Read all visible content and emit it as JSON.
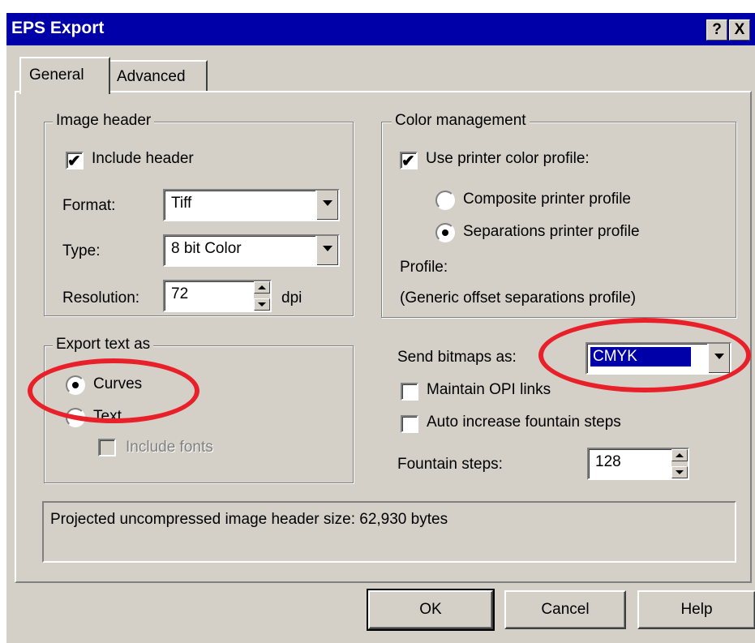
{
  "window": {
    "title": "EPS Export",
    "help_label": "?",
    "close_label": "X"
  },
  "tabs": [
    {
      "label": "General"
    },
    {
      "label": "Advanced"
    }
  ],
  "image_header": {
    "legend": "Image header",
    "include_header": {
      "label": "Include header",
      "checked": true
    },
    "format": {
      "label": "Format:",
      "value": "Tiff"
    },
    "type": {
      "label": "Type:",
      "value": "8 bit Color"
    },
    "resolution": {
      "label": "Resolution:",
      "value": "72",
      "unit": "dpi"
    }
  },
  "color_management": {
    "legend": "Color management",
    "use_printer_profile": {
      "label": "Use printer color profile:",
      "checked": true
    },
    "composite": {
      "label": "Composite printer profile",
      "selected": false
    },
    "separations": {
      "label": "Separations printer profile",
      "selected": true
    },
    "profile_label": "Profile:",
    "profile_value": "(Generic offset separations profile)"
  },
  "export_text": {
    "legend": "Export text as",
    "curves": {
      "label": "Curves",
      "selected": true
    },
    "text": {
      "label": "Text",
      "selected": false
    },
    "include_fonts": {
      "label": "Include fonts",
      "enabled": false
    }
  },
  "bitmaps": {
    "label": "Send bitmaps as:",
    "value": "CMYK",
    "maintain_opi": {
      "label": "Maintain OPI links",
      "checked": false
    },
    "auto_increase": {
      "label": "Auto increase fountain steps",
      "checked": false
    },
    "fountain_label": "Fountain steps:",
    "fountain_value": "128"
  },
  "status": {
    "text": "Projected uncompressed image header size: 62,930 bytes"
  },
  "buttons": {
    "ok": "OK",
    "cancel": "Cancel",
    "help": "Help"
  },
  "colors": {
    "titlebar": "#0000a8",
    "face": "#d4d0c8",
    "highlight_annotation": "#e8202a",
    "selection": "#0000a8"
  }
}
